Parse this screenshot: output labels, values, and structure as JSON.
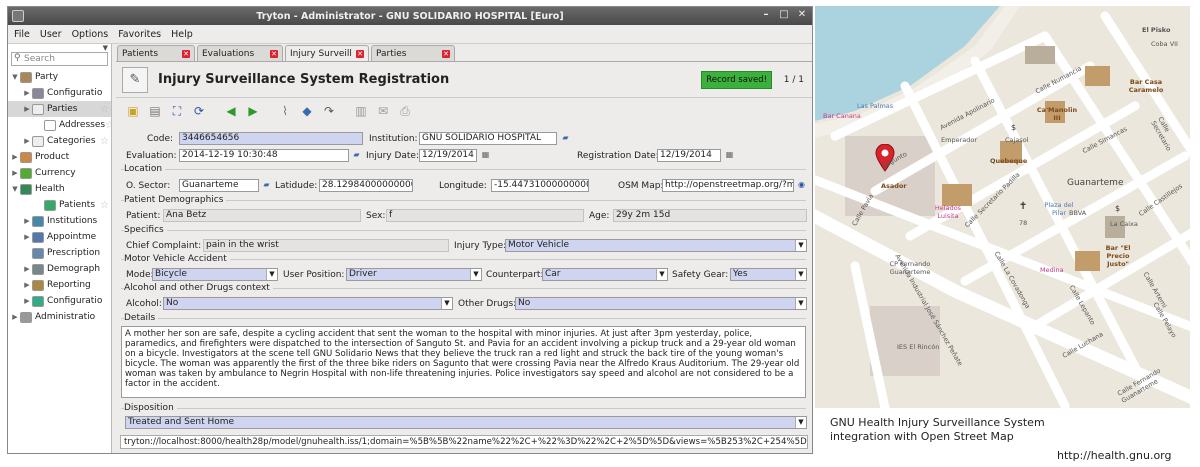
{
  "window": {
    "title": "Tryton - Administrator - GNU SOLIDARIO HOSPITAL [Euro]"
  },
  "menu": [
    "File",
    "User",
    "Options",
    "Favorites",
    "Help"
  ],
  "search": {
    "placeholder": "Search"
  },
  "tree": [
    {
      "label": "Party",
      "arrow": "▼",
      "indent": 0,
      "color": "#a85"
    },
    {
      "label": "Configuratio",
      "arrow": "▶",
      "indent": 1,
      "color": "#889"
    },
    {
      "label": "Parties",
      "arrow": "▶",
      "indent": 1,
      "color": "#eee",
      "selected": true,
      "star": true
    },
    {
      "label": "Addresses",
      "arrow": "",
      "indent": 2,
      "color": "#fff",
      "star": true
    },
    {
      "label": "Categories",
      "arrow": "▶",
      "indent": 1,
      "color": "#eee",
      "star": true
    },
    {
      "label": "Product",
      "arrow": "▶",
      "indent": 0,
      "color": "#c84"
    },
    {
      "label": "Currency",
      "arrow": "▶",
      "indent": 0,
      "color": "#5a3"
    },
    {
      "label": "Health",
      "arrow": "▼",
      "indent": 0,
      "color": "#385"
    },
    {
      "label": "Patients",
      "arrow": "",
      "indent": 2,
      "color": "#3a6",
      "star": true
    },
    {
      "label": "Institutions",
      "arrow": "▶",
      "indent": 1,
      "color": "#48a"
    },
    {
      "label": "Appointme",
      "arrow": "▶",
      "indent": 1,
      "color": "#57a"
    },
    {
      "label": "Prescription",
      "arrow": "",
      "indent": 1,
      "color": "#68a"
    },
    {
      "label": "Demograph",
      "arrow": "▶",
      "indent": 1,
      "color": "#788"
    },
    {
      "label": "Reporting",
      "arrow": "▶",
      "indent": 1,
      "color": "#a84"
    },
    {
      "label": "Configuratio",
      "arrow": "▶",
      "indent": 1,
      "color": "#3a8"
    },
    {
      "label": "Administratio",
      "arrow": "▶",
      "indent": 0,
      "color": "#999"
    }
  ],
  "tabs": [
    "Patients",
    "Evaluations",
    "Injury Surveill...",
    "Parties"
  ],
  "form": {
    "title": "Injury Surveillance System Registration",
    "status": "Record saved!",
    "counter": "1 / 1",
    "code_label": "Code:",
    "code": "3446654656",
    "institution_label": "Institution:",
    "institution": "GNU SOLIDARIO HOSPITAL",
    "evaluation_label": "Evaluation:",
    "evaluation": "2014-12-19 10:30:48",
    "injury_date_label": "Injury Date:",
    "injury_date": "12/19/2014",
    "registration_date_label": "Registration Date:",
    "registration_date": "12/19/2014",
    "location_title": "Location",
    "osector_label": "O. Sector:",
    "osector": "Guanarteme",
    "latitude_label": "Latidude:",
    "latitude": "28.12984000000000",
    "longitude_label": "Longitude:",
    "longitude": "-15.44731000000000",
    "osm_label": "OSM Map:",
    "osm": "http://openstreetmap.org/?ml",
    "demo_title": "Patient Demographics",
    "patient_label": "Patient:",
    "patient": "Ana Betz",
    "sex_label": "Sex:",
    "sex": "f",
    "age_label": "Age:",
    "age": "29y 2m 15d",
    "spec_title": "Specifics",
    "complaint_label": "Chief Complaint:",
    "complaint": "pain in the wrist",
    "injury_type_label": "Injury Type:",
    "injury_type": "Motor Vehicle",
    "mva_title": "Motor Vehicle Accident",
    "mode_label": "Mode:",
    "mode": "Bicycle",
    "user_pos_label": "User Position:",
    "user_pos": "Driver",
    "counterpart_label": "Counterpart:",
    "counterpart": "Car",
    "safety_label": "Safety Gear:",
    "safety": "Yes",
    "alc_title": "Alcohol and other Drugs context",
    "alcohol_label": "Alcohol:",
    "alcohol": "No",
    "drugs_label": "Other Drugs:",
    "drugs": "No",
    "details_title": "Details",
    "details": "A mother her son are safe, despite a cycling accident that sent the woman to the hospital with minor injuries.  At just after 3pm yesterday, police, paramedics, and firefighters were dispatched to the intersection of Sanguto St. and Pavia for an accident involving a pickup truck and a 29-year old woman on a bicycle.  Investigators at the scene tell GNU Solidario News that they believe the truck ran a red light and struck the back tire of the young woman's bicycle.  The woman was apparently the first of the three bike riders on Sagunto that were crossing Pavia near the Alfredo Kraus Auditorium.  The 29-year old woman was taken by ambulance to Negrin Hospital with non-life threatening injuries.  Police investigators say speed and alcohol are not considered to be a factor in the accident.",
    "disposition_title": "Disposition",
    "disposition": "Treated and Sent Home"
  },
  "url": "tryton://localhost:8000/health28p/model/gnuhealth.iss/1;domain=%5B%5B%22name%22%2C+%22%3D%22%2C+2%5D%5D&views=%5B253%2C+254%5D",
  "map": {
    "labels": [
      "El Pisko",
      "Bar Casa Caramelo",
      "Ca'Manolin III",
      "Bar Canana",
      "Las Palmas",
      "Avenida Apolinario",
      "Calle Numancia",
      "Calle Simancas",
      "Calle Secretario",
      "Emperador",
      "Cajasol",
      "Quebeque",
      "Asador",
      "Sagunto",
      "Calle Pavía",
      "Calle Secretario Padilla",
      "Guanarteme",
      "Plaza del Pilar",
      "BBVA",
      "La Caixa",
      "Helados Luisita",
      "Calle Castillejos",
      "Bar \"El Precio Justo\"",
      "CP Fernando Guanarteme",
      "Avenida Industrial José Sánchez Peñate",
      "Calle La Covadonga",
      "Medina",
      "Calle Lepanto",
      "Calle Luchana",
      "IES El Rincón",
      "Calle Fernando Guanarteme",
      "Calle Artemi",
      "Calle Pelayo",
      "Coba VII",
      "78"
    ]
  },
  "caption": [
    "GNU Health Injury Surveillance System",
    "integration with Open Street Map"
  ],
  "credit": "http://health.gnu.org"
}
